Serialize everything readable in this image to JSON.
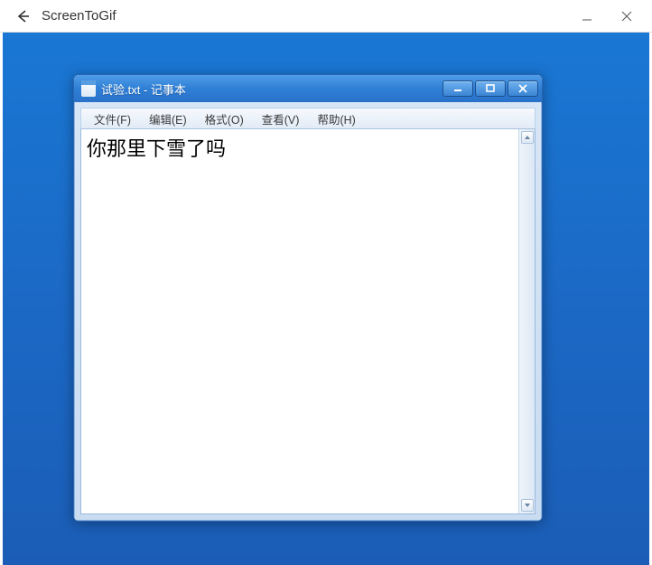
{
  "outer": {
    "title": "ScreenToGif"
  },
  "notepad": {
    "title": "试验.txt - 记事本",
    "menu": {
      "file": {
        "label": "文件",
        "accel": "(F)"
      },
      "edit": {
        "label": "编辑",
        "accel": "(E)"
      },
      "format": {
        "label": "格式",
        "accel": "(O)"
      },
      "view": {
        "label": "查看",
        "accel": "(V)"
      },
      "help": {
        "label": "帮助",
        "accel": "(H)"
      }
    },
    "content": "你那里下雪了吗"
  }
}
